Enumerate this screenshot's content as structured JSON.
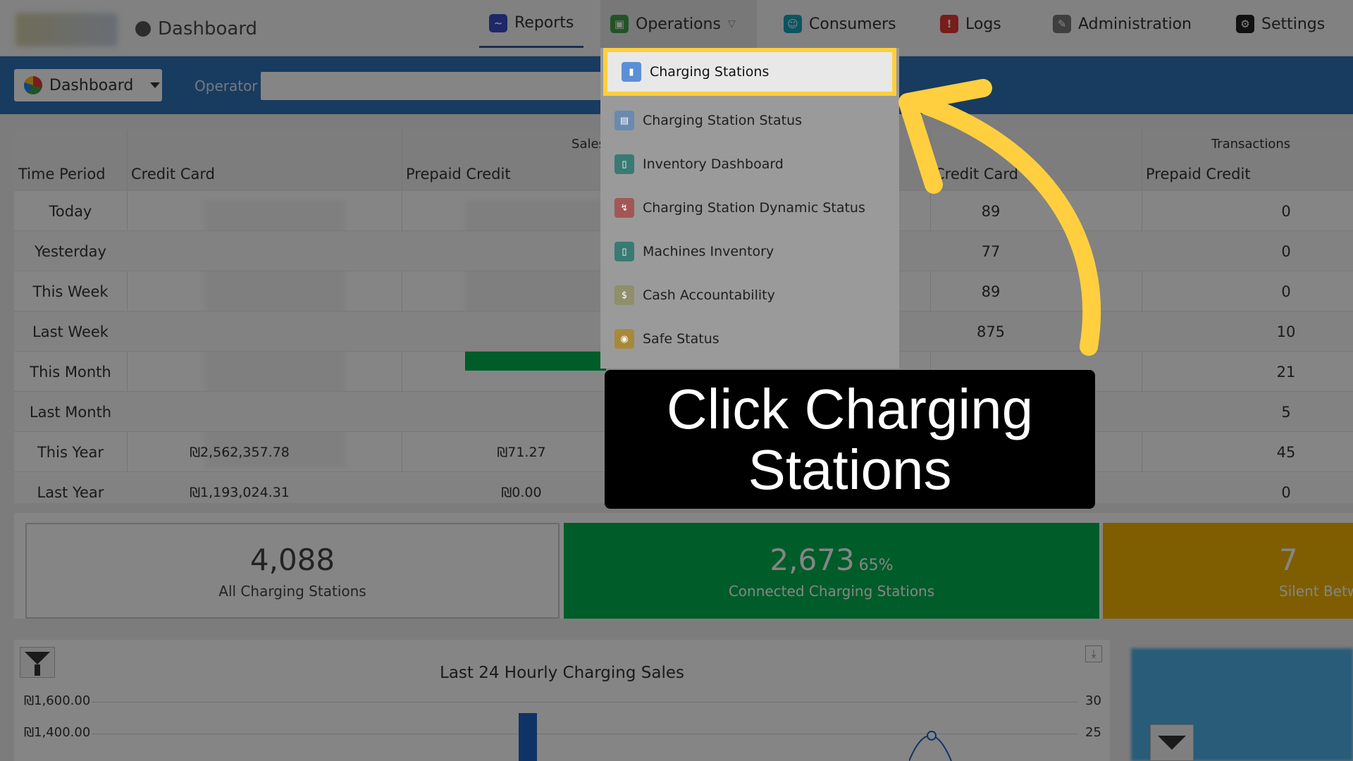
{
  "nav": {
    "brand_label": "Dashboard",
    "items": [
      {
        "label": "Reports",
        "icon": "chart-icon",
        "color": "#3b4bc8"
      },
      {
        "label": "Operations",
        "icon": "operations-icon",
        "color": "#43a047"
      },
      {
        "label": "Consumers",
        "icon": "consumers-icon",
        "color": "#17a2b8"
      },
      {
        "label": "Logs",
        "icon": "alert-icon",
        "color": "#e53935"
      },
      {
        "label": "Administration",
        "icon": "admin-icon",
        "color": "#777777"
      },
      {
        "label": "Settings",
        "icon": "gear-icon",
        "color": "#222222"
      }
    ]
  },
  "toolbar": {
    "dashboard_select": "Dashboard",
    "operator_label": "Operator",
    "operator_value": ""
  },
  "table": {
    "group_headers": {
      "sales": "Sales",
      "transactions": "Transactions"
    },
    "columns": {
      "time_period": "Time Period",
      "credit_card": "Credit Card",
      "prepaid_credit": "Prepaid Credit",
      "t_credit_card": "Credit Card",
      "t_prepaid_credit": "Prepaid Credit"
    },
    "rows": [
      {
        "period": "Today",
        "cc": "",
        "pc": "",
        "tcc": "89",
        "tpc": "0"
      },
      {
        "period": "Yesterday",
        "cc": "",
        "pc": "",
        "tcc": "77",
        "tpc": "0"
      },
      {
        "period": "This Week",
        "cc": "",
        "pc": "",
        "tcc": "89",
        "tpc": "0"
      },
      {
        "period": "Last Week",
        "cc": "",
        "pc": "",
        "tcc": "875",
        "tpc": "10"
      },
      {
        "period": "This Month",
        "cc": "",
        "pc": "",
        "tcc": "",
        "tpc": "21"
      },
      {
        "period": "Last Month",
        "cc": "",
        "pc": "",
        "tcc": "",
        "tpc": "5"
      },
      {
        "period": "This Year",
        "cc": "₪2,562,357.78",
        "pc": "₪71.27",
        "tcc": "",
        "tpc": "45"
      },
      {
        "period": "Last Year",
        "cc": "₪1,193,024.31",
        "pc": "₪0.00",
        "tcc": "",
        "tpc": "0"
      }
    ]
  },
  "cards": [
    {
      "value": "4,088",
      "percent": "",
      "label": "All Charging Stations"
    },
    {
      "value": "2,673",
      "percent": "65%",
      "label": "Connected Charging Stations"
    },
    {
      "value": "7",
      "percent": "",
      "label": "Silent Betw"
    }
  ],
  "chart": {
    "title": "Last 24 Hourly Charging Sales",
    "y_left_ticks": [
      "₪1,600.00",
      "₪1,400.00"
    ],
    "y_right_ticks": [
      "30",
      "25"
    ]
  },
  "chart_data": {
    "type": "bar",
    "title": "Last 24 Hourly Charging Sales",
    "y_left_ticks": [
      "₪1,600.00",
      "₪1,400.00"
    ],
    "y_right_ticks": [
      "30",
      "25"
    ]
  },
  "menu": {
    "items": [
      {
        "label": "Charging Stations",
        "icon": "charging-station-icon"
      },
      {
        "label": "Charging Station Status",
        "icon": "status-icon"
      },
      {
        "label": "Inventory Dashboard",
        "icon": "inventory-icon"
      },
      {
        "label": "Charging Station Dynamic Status",
        "icon": "dynamic-status-icon"
      },
      {
        "label": "Machines Inventory",
        "icon": "machines-icon"
      },
      {
        "label": "Cash Accountability",
        "icon": "cash-icon"
      },
      {
        "label": "Safe Status",
        "icon": "safe-icon"
      }
    ]
  },
  "callout": {
    "text": "Click Charging Stations"
  },
  "colors": {
    "toolbar_blue": "#2f72b8",
    "highlight_yellow": "#ffcf3f",
    "card_green": "#00b050",
    "card_yellow": "#f2b400"
  }
}
